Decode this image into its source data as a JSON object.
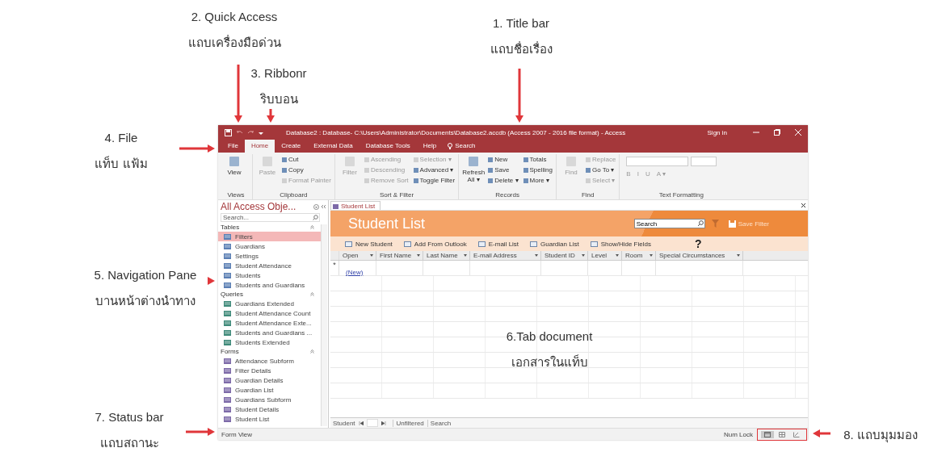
{
  "annotations": [
    {
      "kind": "down",
      "caption": "1. Title bar",
      "thai": "แถบชื่อเรื่อง"
    },
    {
      "kind": "down",
      "caption": "2. Quick Access",
      "thai": "แถบเครื่องมือด่วน"
    },
    {
      "kind": "down",
      "caption": "3. Ribbonr",
      "thai": "ริบบอน"
    },
    {
      "kind": "right",
      "caption": "4. File",
      "thai": "แท็บ แฟ้ม"
    },
    {
      "kind": "right",
      "caption": "5. Navigation  Pane",
      "thai": "บานหน้าต่างนำทาง"
    },
    {
      "kind": "none",
      "caption": "6.Tab document",
      "thai": "เอกสารในแท็บ"
    },
    {
      "kind": "right",
      "caption": "7. Status bar",
      "thai": "แถบสถานะ"
    },
    {
      "kind": "left",
      "caption": "8. แถบมุมมอง"
    }
  ],
  "window": {
    "title": "Database2 : Database- C:\\Users\\Administrator\\Documents\\Database2.accdb (Access 2007 - 2016 file format)  -  Access",
    "sign_in": "Sign in"
  },
  "ribbon_tabs": [
    {
      "label": "File",
      "selected": false,
      "kind": "tab"
    },
    {
      "label": "Home",
      "selected": true,
      "kind": "tab"
    },
    {
      "label": "Create",
      "selected": false,
      "kind": "tab"
    },
    {
      "label": "External Data",
      "selected": false,
      "kind": "tab"
    },
    {
      "label": "Database Tools",
      "selected": false,
      "kind": "tab"
    },
    {
      "label": "Help",
      "selected": false,
      "kind": "tab"
    },
    {
      "label": "Search",
      "selected": false,
      "kind": "search"
    }
  ],
  "ribbon_groups": [
    {
      "label": "Views",
      "items": [
        {
          "label": "View",
          "kind": "large",
          "disabled": false
        }
      ]
    },
    {
      "label": "Clipboard",
      "items": [
        {
          "label": "Paste",
          "kind": "large",
          "disabled": true
        },
        {
          "label": "Cut",
          "kind": "small",
          "disabled": false
        },
        {
          "label": "Copy",
          "kind": "small",
          "disabled": false
        },
        {
          "label": "Format Painter",
          "kind": "small",
          "disabled": true
        }
      ]
    },
    {
      "label": "Sort & Filter",
      "items": [
        {
          "label": "Filter",
          "kind": "large",
          "disabled": true
        },
        {
          "label": "Ascending",
          "kind": "small",
          "disabled": true
        },
        {
          "label": "Descending",
          "kind": "small",
          "disabled": true
        },
        {
          "label": "Remove Sort",
          "kind": "small",
          "disabled": true
        },
        {
          "label": "Selection ▾",
          "kind": "small",
          "disabled": true
        },
        {
          "label": "Advanced ▾",
          "kind": "small",
          "disabled": false
        },
        {
          "label": "Toggle Filter",
          "kind": "small",
          "disabled": false
        }
      ]
    },
    {
      "label": "Records",
      "items": [
        {
          "label": "Refresh All ▾",
          "kind": "large",
          "disabled": false
        },
        {
          "label": "New",
          "kind": "small",
          "disabled": false
        },
        {
          "label": "Save",
          "kind": "small",
          "disabled": false
        },
        {
          "label": "Delete ▾",
          "kind": "small",
          "disabled": false
        },
        {
          "label": "Totals",
          "kind": "small",
          "disabled": false
        },
        {
          "label": "Spelling",
          "kind": "small",
          "disabled": false
        },
        {
          "label": "More ▾",
          "kind": "small",
          "disabled": false
        }
      ]
    },
    {
      "label": "Find",
      "items": [
        {
          "label": "Find",
          "kind": "large",
          "disabled": true
        },
        {
          "label": "Replace",
          "kind": "small",
          "disabled": true
        },
        {
          "label": "Go To ▾",
          "kind": "small",
          "disabled": false
        },
        {
          "label": "Select ▾",
          "kind": "small",
          "disabled": true
        }
      ]
    },
    {
      "label": "Text Formatting",
      "items": [
        {
          "label": "B",
          "kind": "format",
          "disabled": true
        },
        {
          "label": "I",
          "kind": "format",
          "disabled": true
        },
        {
          "label": "U",
          "kind": "format",
          "disabled": true
        },
        {
          "label": "A ▾",
          "kind": "format",
          "disabled": true
        }
      ]
    }
  ],
  "nav_pane": {
    "title": "All Access Obje...",
    "search_placeholder": "Search...",
    "groups": [
      {
        "label": "Tables",
        "kind": "table",
        "items": [
          {
            "label": "Filters",
            "selected": true
          },
          {
            "label": "Guardians",
            "selected": false
          },
          {
            "label": "Settings",
            "selected": false
          },
          {
            "label": "Student Attendance",
            "selected": false
          },
          {
            "label": "Students",
            "selected": false
          },
          {
            "label": "Students and Guardians",
            "selected": false
          }
        ]
      },
      {
        "label": "Queries",
        "kind": "query",
        "items": [
          {
            "label": "Guardians Extended",
            "selected": false
          },
          {
            "label": "Student Attendance Count",
            "selected": false
          },
          {
            "label": "Student Attendance Exte...",
            "selected": false
          },
          {
            "label": "Students and Guardians ...",
            "selected": false
          },
          {
            "label": "Students Extended",
            "selected": false
          }
        ]
      },
      {
        "label": "Forms",
        "kind": "form",
        "items": [
          {
            "label": "Attendance Subform",
            "selected": false
          },
          {
            "label": "Filter Details",
            "selected": false
          },
          {
            "label": "Guardian Details",
            "selected": false
          },
          {
            "label": "Guardian List",
            "selected": false
          },
          {
            "label": "Guardians Subform",
            "selected": false
          },
          {
            "label": "Student Details",
            "selected": false
          },
          {
            "label": "Student List",
            "selected": false
          }
        ]
      }
    ]
  },
  "document": {
    "tab": "Student List",
    "heading": "Student List",
    "search_value": "Search",
    "save_filter": "Save Filter",
    "actions": [
      "New Student",
      "Add From Outlook",
      "E-mail List",
      "Guardian List",
      "Show/Hide Fields"
    ],
    "help": "?",
    "columns": [
      "Open",
      "First Name",
      "Last Name",
      "E-mail Address",
      "Student ID",
      "Level",
      "Room",
      "Special Circumstances"
    ],
    "new_row_marker": "*",
    "new_row_link": "(New)",
    "record_nav": {
      "label": "Student",
      "filter": "Unfiltered",
      "search": "Search"
    }
  },
  "status_bar": {
    "view": "Form View",
    "num_lock": "Num Lock",
    "view_buttons": [
      {
        "kind": "form",
        "selected": true
      },
      {
        "kind": "datasheet",
        "selected": false
      },
      {
        "kind": "layout",
        "selected": false
      }
    ]
  }
}
